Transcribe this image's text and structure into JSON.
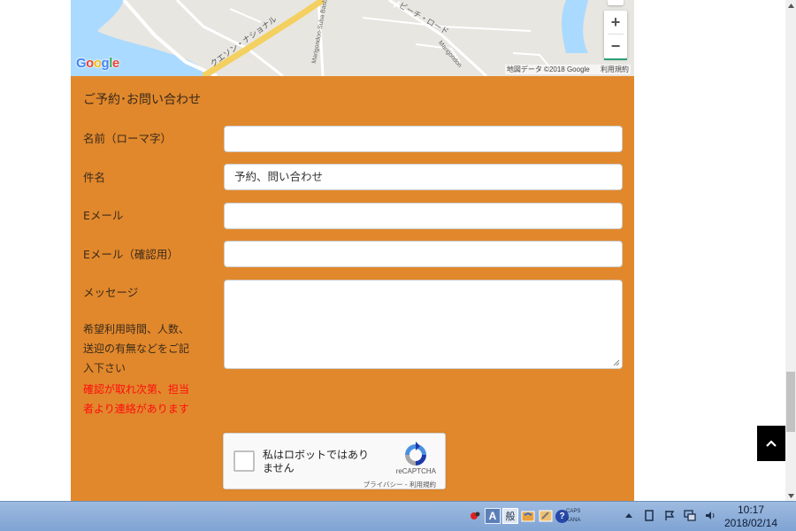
{
  "map": {
    "logo_letters": [
      "G",
      "o",
      "o",
      "g",
      "l",
      "e"
    ],
    "attribution": "地図データ ©2018 Google",
    "terms": "利用規約",
    "road_label_1": "クエソン・ナショナル",
    "road_label_2": "Marigondon-Suba Basb",
    "road_label_3": "ビーチ・ロード",
    "road_label_4": "Marigondon",
    "zoom_in": "+",
    "zoom_out": "−"
  },
  "form": {
    "title": "ご予約･お問い合わせ",
    "name_label": "名前（ローマ字）",
    "name_value": "",
    "subject_label": "件名",
    "subject_value": "予約、問い合わせ",
    "email_label": "Eメール",
    "email_value": "",
    "email_confirm_label": "Eメール（確認用）",
    "email_confirm_value": "",
    "message_label": "メッセージ",
    "note_lines": [
      "希望利用時間、人数、",
      "送迎の有無などをご記",
      "入下さい"
    ],
    "note_red_lines": [
      "確認が取れ次第、担当",
      "者より連絡があります"
    ]
  },
  "recaptcha": {
    "label": "私はロボットではありません",
    "brand": "reCAPTCHA",
    "links": "プライバシー - 利用規約"
  },
  "taskbar": {
    "ime_mode": "A",
    "ime_gen": "般",
    "help": "?",
    "caps": "CAPS",
    "kana": "KANA",
    "time": "10:17",
    "date": "2018/02/14"
  },
  "colors": {
    "form_bg": "#e1882c",
    "note_red": "#ff0d0d",
    "zoom_accent": "#2ba07a"
  }
}
